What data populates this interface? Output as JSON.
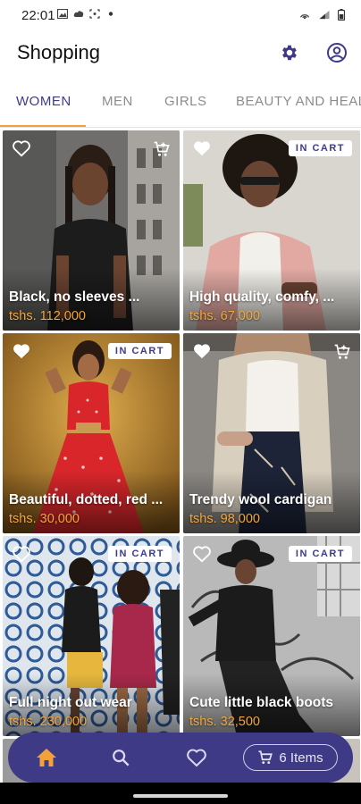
{
  "status_bar": {
    "time": "22:01"
  },
  "app_bar": {
    "title": "Shopping"
  },
  "tabs": [
    {
      "label": "WOMEN",
      "active": true
    },
    {
      "label": "MEN",
      "active": false
    },
    {
      "label": "GIRLS",
      "active": false
    },
    {
      "label": "BEAUTY AND HEALTH",
      "active": false
    }
  ],
  "products": [
    {
      "title": "Black, no sleeves ...",
      "price": "tshs. 112,000",
      "favorite": false,
      "in_cart": false,
      "bg": "#7d7d7d"
    },
    {
      "title": "High quality, comfy, ...",
      "price": "tshs. 67,000",
      "favorite": true,
      "in_cart": true,
      "badge": "IN CART",
      "bg": "#c9a592"
    },
    {
      "title": "Beautiful, dotted, red ...",
      "price": "tshs. 30,000",
      "favorite": true,
      "in_cart": true,
      "badge": "IN CART",
      "bg": "#c98a2c"
    },
    {
      "title": "Trendy wool cardigan",
      "price": "tshs. 98,000",
      "favorite": true,
      "in_cart": false,
      "bg": "#8e8a86"
    },
    {
      "title": "Full night out wear",
      "price": "tshs. 230,000",
      "favorite": false,
      "in_cart": true,
      "badge": "IN CART",
      "bg": "#5f7fa6"
    },
    {
      "title": "Cute little black boots",
      "price": "tshs. 32,500",
      "favorite": false,
      "in_cart": true,
      "badge": "IN CART",
      "bg": "#a3a3a3"
    }
  ],
  "bottom_nav": {
    "cart_label": "6 Items"
  },
  "colors": {
    "primary": "#3f3a86",
    "accent": "#f5a13a",
    "tab_active": "#3d3b8a",
    "tab_inactive": "#8c8c8c"
  }
}
